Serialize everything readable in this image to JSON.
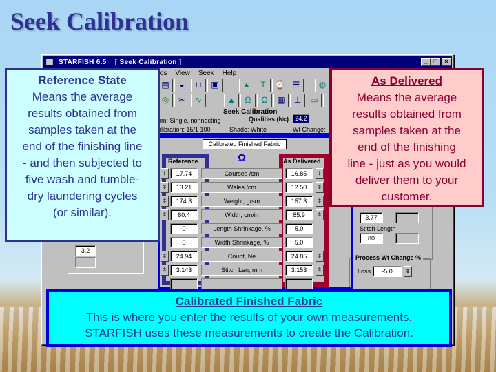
{
  "slide": {
    "title": "Seek Calibration"
  },
  "window": {
    "title": "STARFISH 6.5    [ Seek Calibration ]",
    "controls": {
      "minimize": "_",
      "maximize": "□",
      "close": "×"
    },
    "menu": [
      "tos",
      "View",
      "Seek",
      "Help"
    ]
  },
  "toolbar": {
    "row1": [
      "fabric-icon",
      "roll-icon",
      "dyeing-icon",
      "monitor-icon",
      "triangle-icon",
      "garment-icon",
      "machine-icon",
      "table-icon",
      "globe-icon"
    ],
    "row2": [
      "target-icon",
      "scissors-icon",
      "wave-icon",
      "bell-icon",
      "omega-icon",
      "bell-omega-icon",
      "grid-icon",
      "computer-icon",
      "screen-icon",
      "book-icon"
    ]
  },
  "seek_calibration": {
    "group_label": "Seek Calibration",
    "program_label": "am: Single, nonnecting",
    "calibration_label": "alibration: 15/1 100",
    "qualities_label": "Qualities (Nc)",
    "qualities_value": "24.2",
    "shade_label": "Shade: White",
    "wt_change_label": "Wt Change:"
  },
  "calibrated_fabric": {
    "tab_label": "Calibrated Finished Fabric",
    "reference_header": "Reference",
    "delivered_header": "As Delivered",
    "rows": [
      {
        "param": "Courses /cm",
        "reference": "17.74",
        "delivered": "16.85",
        "spin": true
      },
      {
        "param": "Wales /cm",
        "reference": "13.21",
        "delivered": "12.50",
        "spin": true
      },
      {
        "param": "Weight, g/sm",
        "reference": "174.3",
        "delivered": "157.3",
        "spin": true
      },
      {
        "param": "Width, cm/in",
        "reference": "80.4",
        "delivered": "85.9",
        "spin": true
      },
      {
        "param": "Length Shrinkage, %",
        "reference": "0",
        "delivered": "5.0",
        "spin": false
      },
      {
        "param": "Width Shrinkage, %",
        "reference": "0",
        "delivered": "5.0",
        "spin": false
      },
      {
        "param": "Count, Ne",
        "reference": "24.94",
        "delivered": "24.85",
        "spin": true
      },
      {
        "param": "Stitch Len, mm",
        "reference": "3.143",
        "delivered": "3.153",
        "spin": true
      },
      {
        "param": "",
        "reference": "",
        "delivered": "",
        "spin": false
      },
      {
        "param": "",
        "reference": "",
        "delivered": "",
        "spin": false
      }
    ]
  },
  "left_panel": {
    "value": "3.2"
  },
  "right_panel": {
    "value1": "3.77",
    "stitch_length_label": "Stitch Length",
    "stitch_length_value": "80",
    "process_group_label": "Process Wt Change %",
    "loss_label": "Loss",
    "loss_value": "-5.0"
  },
  "callouts": {
    "reference": {
      "title": "Reference State",
      "lines": [
        "Means the average",
        "results obtained from",
        "samples taken at the",
        "end of the finishing line",
        "- and then subjected to",
        "five wash and tumble-",
        "dry laundering cycles",
        "(or similar)."
      ]
    },
    "delivered": {
      "title": "As Delivered",
      "lines": [
        "Means the average",
        "results obtained from",
        "samples taken at the",
        "end of the finishing",
        "line - just as you would",
        "deliver them to your",
        "customer."
      ]
    },
    "calibrated": {
      "title": "Calibrated Finished Fabric",
      "lines": [
        "This is where you enter the results of your own measurements.",
        "STARFISH uses these measurements to create the Calibration."
      ]
    }
  },
  "colors": {
    "reference": "#2e3192",
    "delivered": "#a0002a",
    "highlight": "#0000d8",
    "titlebar": "#00007b"
  }
}
